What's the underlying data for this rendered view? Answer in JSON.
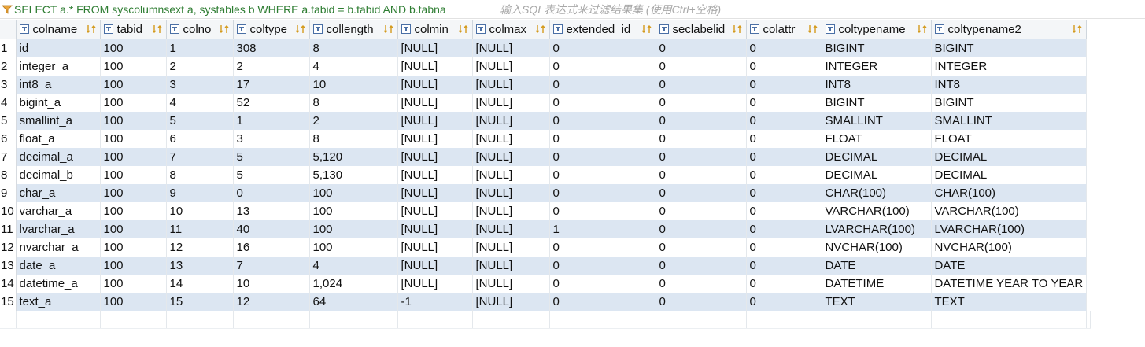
{
  "filter": {
    "query": "SELECT a.* FROM syscolumnsext a, systables b WHERE a.tabid = b.tabid AND b.tabna",
    "placeholder": "输入SQL表达式来过滤结果集 (使用Ctrl+空格)"
  },
  "columns": [
    {
      "key": "colname",
      "label": "colname"
    },
    {
      "key": "tabid",
      "label": "tabid"
    },
    {
      "key": "colno",
      "label": "colno"
    },
    {
      "key": "coltype",
      "label": "coltype"
    },
    {
      "key": "collength",
      "label": "collength"
    },
    {
      "key": "colmin",
      "label": "colmin"
    },
    {
      "key": "colmax",
      "label": "colmax"
    },
    {
      "key": "extended_id",
      "label": "extended_id"
    },
    {
      "key": "seclabelid",
      "label": "seclabelid"
    },
    {
      "key": "colattr",
      "label": "colattr"
    },
    {
      "key": "coltypename",
      "label": "coltypename"
    },
    {
      "key": "coltypename2",
      "label": "coltypename2"
    }
  ],
  "rows": [
    {
      "num": "1",
      "cells": [
        "id",
        "100",
        "1",
        "308",
        "8",
        "[NULL]",
        "[NULL]",
        "0",
        "0",
        "0",
        "BIGINT",
        "BIGINT"
      ]
    },
    {
      "num": "2",
      "cells": [
        "integer_a",
        "100",
        "2",
        "2",
        "4",
        "[NULL]",
        "[NULL]",
        "0",
        "0",
        "0",
        "INTEGER",
        "INTEGER"
      ]
    },
    {
      "num": "3",
      "cells": [
        "int8_a",
        "100",
        "3",
        "17",
        "10",
        "[NULL]",
        "[NULL]",
        "0",
        "0",
        "0",
        "INT8",
        "INT8"
      ]
    },
    {
      "num": "4",
      "cells": [
        "bigint_a",
        "100",
        "4",
        "52",
        "8",
        "[NULL]",
        "[NULL]",
        "0",
        "0",
        "0",
        "BIGINT",
        "BIGINT"
      ]
    },
    {
      "num": "5",
      "cells": [
        "smallint_a",
        "100",
        "5",
        "1",
        "2",
        "[NULL]",
        "[NULL]",
        "0",
        "0",
        "0",
        "SMALLINT",
        "SMALLINT"
      ]
    },
    {
      "num": "6",
      "cells": [
        "float_a",
        "100",
        "6",
        "3",
        "8",
        "[NULL]",
        "[NULL]",
        "0",
        "0",
        "0",
        "FLOAT",
        "FLOAT"
      ]
    },
    {
      "num": "7",
      "cells": [
        "decimal_a",
        "100",
        "7",
        "5",
        "5,120",
        "[NULL]",
        "[NULL]",
        "0",
        "0",
        "0",
        "DECIMAL",
        "DECIMAL"
      ]
    },
    {
      "num": "8",
      "cells": [
        "decimal_b",
        "100",
        "8",
        "5",
        "5,130",
        "[NULL]",
        "[NULL]",
        "0",
        "0",
        "0",
        "DECIMAL",
        "DECIMAL"
      ]
    },
    {
      "num": "9",
      "cells": [
        "char_a",
        "100",
        "9",
        "0",
        "100",
        "[NULL]",
        "[NULL]",
        "0",
        "0",
        "0",
        "CHAR(100)",
        "CHAR(100)"
      ]
    },
    {
      "num": "10",
      "cells": [
        "varchar_a",
        "100",
        "10",
        "13",
        "100",
        "[NULL]",
        "[NULL]",
        "0",
        "0",
        "0",
        "VARCHAR(100)",
        "VARCHAR(100)"
      ]
    },
    {
      "num": "11",
      "cells": [
        "lvarchar_a",
        "100",
        "11",
        "40",
        "100",
        "[NULL]",
        "[NULL]",
        "1",
        "0",
        "0",
        "LVARCHAR(100)",
        "LVARCHAR(100)"
      ]
    },
    {
      "num": "12",
      "cells": [
        "nvarchar_a",
        "100",
        "12",
        "16",
        "100",
        "[NULL]",
        "[NULL]",
        "0",
        "0",
        "0",
        "NVCHAR(100)",
        "NVCHAR(100)"
      ]
    },
    {
      "num": "13",
      "cells": [
        "date_a",
        "100",
        "13",
        "7",
        "4",
        "[NULL]",
        "[NULL]",
        "0",
        "0",
        "0",
        "DATE",
        "DATE"
      ]
    },
    {
      "num": "14",
      "cells": [
        "datetime_a",
        "100",
        "14",
        "10",
        "1,024",
        "[NULL]",
        "[NULL]",
        "0",
        "0",
        "0",
        "DATETIME",
        "DATETIME YEAR TO YEAR"
      ]
    },
    {
      "num": "15",
      "cells": [
        "text_a",
        "100",
        "15",
        "12",
        "64",
        "-1",
        "[NULL]",
        "0",
        "0",
        "0",
        "TEXT",
        "TEXT"
      ]
    }
  ],
  "colors": {
    "query_text": "#2e7d32",
    "alt_row": "#dce6f2",
    "null_text": "#9aa3ad"
  },
  "icons": {
    "filter": "funnel-icon",
    "column": "column-key-icon",
    "sort": "sort-arrows-icon"
  }
}
